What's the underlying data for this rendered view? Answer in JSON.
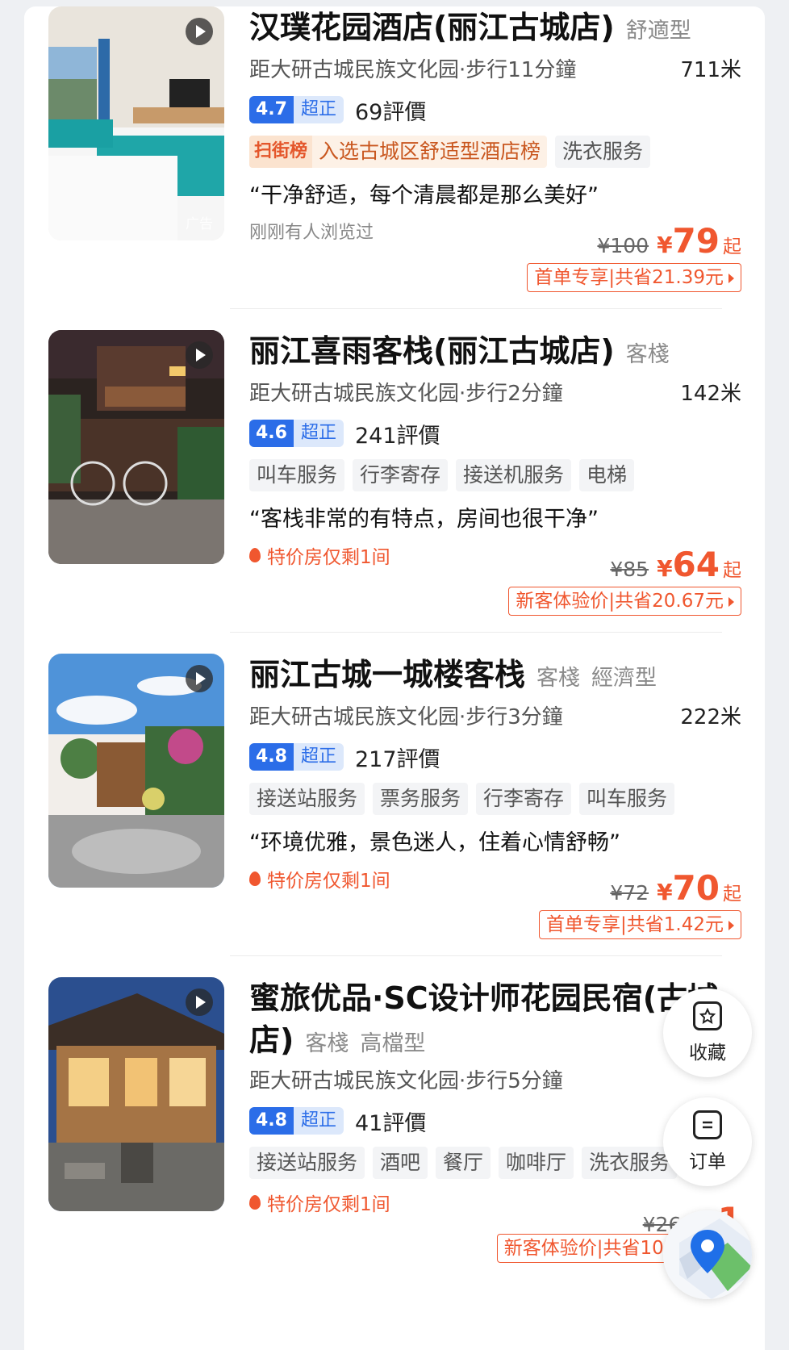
{
  "hotels": [
    {
      "name": "汉璞花园酒店(丽江古城店)",
      "types": [
        "舒適型"
      ],
      "distance": "距大研古城民族文化园·步行11分鐘",
      "meters": "711米",
      "score": "4.7",
      "grade": "超正",
      "reviews": "69評價",
      "rank_logo": "扫街榜",
      "rank_text": "入选古城区舒适型酒店榜",
      "tags": [
        "洗衣服务"
      ],
      "quote": "“干净舒适，每个清晨都是那么美好”",
      "note": "刚刚有人浏览过",
      "ad_label": "广告",
      "orig_price": "¥100",
      "yen": "¥",
      "price": "79",
      "qi": "起",
      "promo": "首单专享|共省21.39元"
    },
    {
      "name": "丽江喜雨客栈(丽江古城店)",
      "types": [
        "客棧"
      ],
      "distance": "距大研古城民族文化园·步行2分鐘",
      "meters": "142米",
      "score": "4.6",
      "grade": "超正",
      "reviews": "241評價",
      "tags": [
        "叫车服务",
        "行李寄存",
        "接送机服务",
        "电梯"
      ],
      "quote": "“客栈非常的有特点，房间也很干净”",
      "note": "特价房仅剩1间",
      "orig_price": "¥85",
      "yen": "¥",
      "price": "64",
      "qi": "起",
      "promo": "新客体验价|共省20.67元"
    },
    {
      "name": "丽江古城一城楼客栈",
      "types": [
        "客棧",
        "經濟型"
      ],
      "distance": "距大研古城民族文化园·步行3分鐘",
      "meters": "222米",
      "score": "4.8",
      "grade": "超正",
      "reviews": "217評價",
      "tags": [
        "接送站服务",
        "票务服务",
        "行李寄存",
        "叫车服务"
      ],
      "quote": "“环境优雅，景色迷人，住着心情舒畅”",
      "note": "特价房仅剩1间",
      "orig_price": "¥72",
      "yen": "¥",
      "price": "70",
      "qi": "起",
      "promo": "首单专享|共省1.42元"
    },
    {
      "name": "蜜旅优品·SC设计师花园民宿(古城店)",
      "types": [
        "客棧",
        "高檔型"
      ],
      "distance": "距大研古城民族文化园·步行5分鐘",
      "score": "4.8",
      "grade": "超正",
      "reviews": "41評價",
      "tags": [
        "接送站服务",
        "酒吧",
        "餐厅",
        "咖啡厅",
        "洗衣服务"
      ],
      "note": "特价房仅剩1间",
      "orig_price": "¥268",
      "yen": "¥",
      "price": "1",
      "promo": "新客体验价|共省102.63元"
    }
  ],
  "fabs": {
    "favorite_label": "收藏",
    "orders_label": "订单"
  }
}
